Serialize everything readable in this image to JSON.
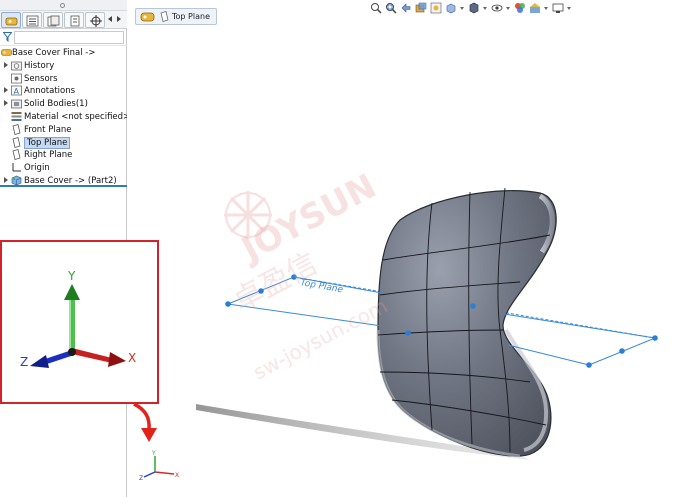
{
  "feature_tree": {
    "root": "Base Cover Final ->",
    "items": [
      {
        "label": "History",
        "icon": "history-folder-icon",
        "expandable": true
      },
      {
        "label": "Sensors",
        "icon": "sensors-icon",
        "expandable": false
      },
      {
        "label": "Annotations",
        "icon": "annotations-icon",
        "expandable": true
      },
      {
        "label": "Solid Bodies(1)",
        "icon": "solid-bodies-folder-icon",
        "expandable": true
      },
      {
        "label": "Material <not specified>",
        "icon": "material-icon",
        "expandable": false
      },
      {
        "label": "Front Plane",
        "icon": "plane-icon",
        "expandable": false
      },
      {
        "label": "Top Plane",
        "icon": "plane-icon",
        "expandable": false,
        "selected": true
      },
      {
        "label": "Right Plane",
        "icon": "plane-icon",
        "expandable": false
      },
      {
        "label": "Origin",
        "icon": "origin-icon",
        "expandable": false
      },
      {
        "label": "Base Cover -> (Part2)",
        "icon": "part-icon",
        "expandable": true
      }
    ]
  },
  "panel_tabs": [
    "feature-manager-tab",
    "property-manager-tab",
    "configuration-manager-tab",
    "dimxpert-tab",
    "display-manager-tab"
  ],
  "breadcrumb": {
    "selection": "Top Plane"
  },
  "viewport": {
    "plane_label": "Top Plane",
    "axes": {
      "x": "X",
      "y": "Y",
      "z": "Z"
    },
    "watermark": {
      "brand": "JOYSUN",
      "cjk": "卓盈信",
      "url": "sw-joysun.com"
    }
  },
  "colors": {
    "selection_blue": "#2f86d6",
    "callout_red": "#d3222a",
    "axis_x": "#d42a2a",
    "axis_y": "#2fa62f",
    "axis_z": "#2a3ccf",
    "body_gray": "#6c7180"
  }
}
